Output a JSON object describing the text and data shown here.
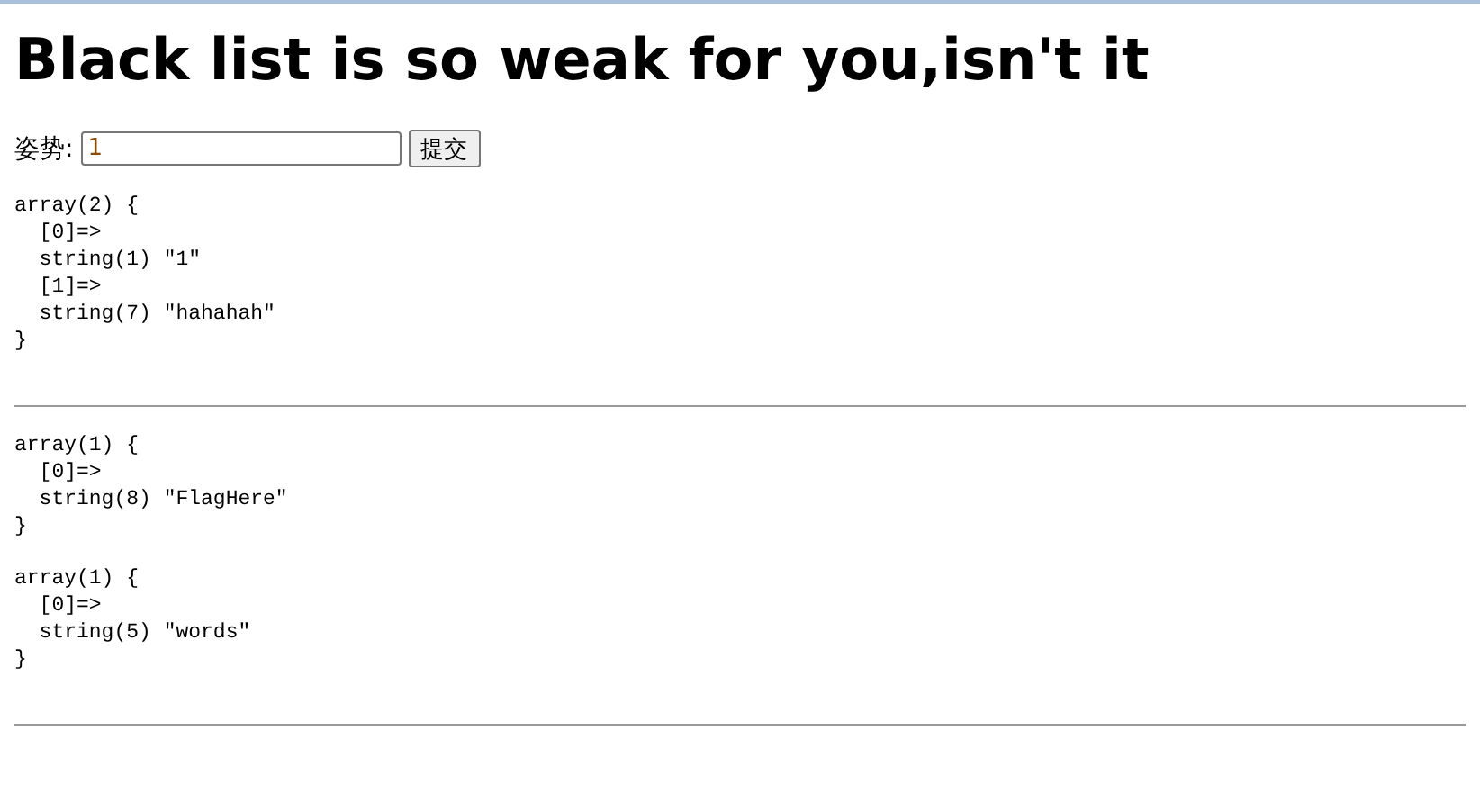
{
  "heading": "Black list is so weak for you,isn't it",
  "form": {
    "label": "姿势:",
    "value": "1",
    "button": "提交"
  },
  "sections": [
    {
      "dumps": [
        "array(2) {\n  [0]=>\n  string(1) \"1\"\n  [1]=>\n  string(7) \"hahahah\"\n}"
      ]
    },
    {
      "dumps": [
        "array(1) {\n  [0]=>\n  string(8) \"FlagHere\"\n}",
        "array(1) {\n  [0]=>\n  string(5) \"words\"\n}"
      ]
    }
  ]
}
